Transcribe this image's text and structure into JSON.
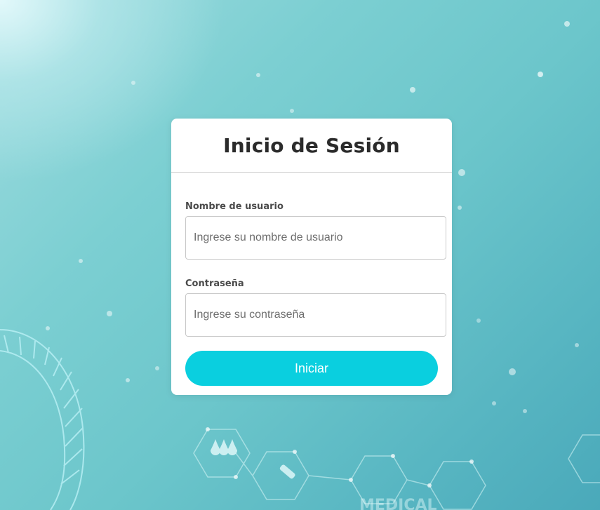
{
  "login": {
    "title": "Inicio de Sesión",
    "username_label": "Nombre de usuario",
    "username_placeholder": "Ingrese su nombre de usuario",
    "username_value": "",
    "password_label": "Contraseña",
    "password_placeholder": "Ingrese su contraseña",
    "password_value": "",
    "submit_label": "Iniciar"
  },
  "theme": {
    "background_start": "#9fdcdf",
    "background_end": "#4aa9ba",
    "button_color": "#0acfdf",
    "card_color": "#ffffff",
    "title_color": "#2b2b2b"
  },
  "background": {
    "illustration_text": "MEDICAL"
  }
}
